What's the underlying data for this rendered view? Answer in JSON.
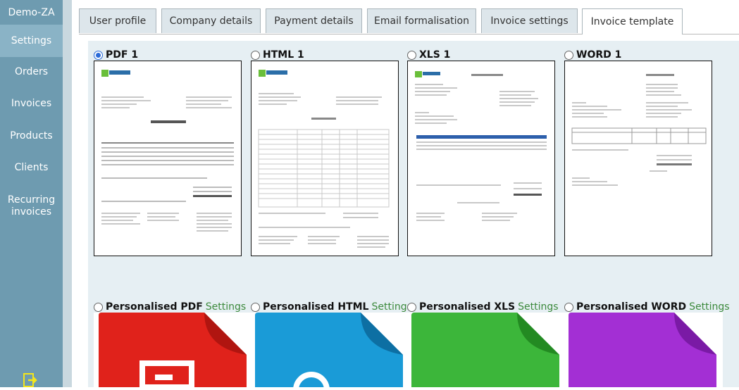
{
  "sidebar": {
    "brand": "Demo-ZA",
    "items": [
      {
        "label": "Settings",
        "active": true
      },
      {
        "label": "Orders"
      },
      {
        "label": "Invoices"
      },
      {
        "label": "Products"
      },
      {
        "label": "Clients"
      },
      {
        "label": "Recurring invoices"
      }
    ],
    "logout_icon": "logout-icon"
  },
  "tabs": [
    {
      "label": "User profile"
    },
    {
      "label": "Company details"
    },
    {
      "label": "Payment details"
    },
    {
      "label": "Email formalisation"
    },
    {
      "label": "Invoice settings"
    },
    {
      "label": "Invoice template",
      "active": true
    }
  ],
  "templates": [
    {
      "label": "PDF 1",
      "selected": true
    },
    {
      "label": "HTML 1"
    },
    {
      "label": "XLS 1"
    },
    {
      "label": "WORD 1"
    }
  ],
  "personalised": {
    "settings_label": "Settings",
    "items": [
      {
        "label": "Personalised PDF",
        "color": "#e0221b"
      },
      {
        "label": "Personalised HTML",
        "color": "#1a9bd7"
      },
      {
        "label": "Personalised XLS",
        "color": "#3cb63a"
      },
      {
        "label": "Personalised WORD",
        "color": "#a32fd4"
      }
    ]
  },
  "colors": {
    "sidebar": "#6e9bb0",
    "sidebar_active": "#8ab3c6",
    "settings_link": "#3d8a3d",
    "radio_selected": "#2a6ad8"
  }
}
